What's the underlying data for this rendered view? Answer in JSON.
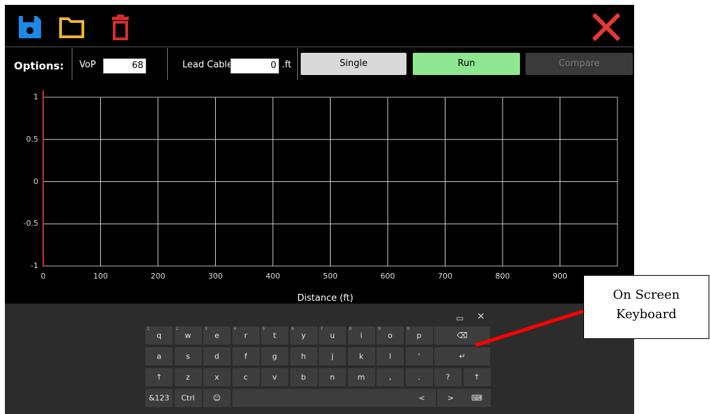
{
  "toolbar": {
    "icons": [
      "save-icon",
      "open-folder-icon",
      "delete-icon",
      "close-icon"
    ],
    "colors": {
      "save": "#1e88e5",
      "folder": "#f0b429",
      "delete": "#d32f2f",
      "close": "#e53935"
    }
  },
  "options": {
    "label": "Options:",
    "vop_label": "VoP",
    "vop_value": "68",
    "lead_cable_label": "Lead Cable",
    "lead_cable_value": "0",
    "lead_cable_unit": ".ft",
    "buttons": {
      "single": "Single",
      "run": "Run",
      "compare": "Compare"
    },
    "colors": {
      "single_bg": "#d9d9d9",
      "run_bg": "#8ee68e",
      "compare_bg": "#3a3a3a",
      "compare_text": "#7a7a7a"
    }
  },
  "chart_data": {
    "type": "line",
    "xlabel": "Distance (ft)",
    "ylabel": "",
    "title": "",
    "xlim": [
      0,
      1000
    ],
    "ylim": [
      -1,
      1
    ],
    "x_ticks": [
      "0",
      "100",
      "200",
      "300",
      "400",
      "500",
      "600",
      "700",
      "800",
      "900"
    ],
    "y_ticks": [
      "1",
      "0.5",
      "0",
      "-0.5",
      "-1"
    ],
    "grid": true,
    "series": [],
    "colors": {
      "background": "#000000",
      "grid": "#ffffff",
      "cursor": "#d32f2f"
    }
  },
  "keyboard": {
    "top_icons": [
      "keyboard-layout-icon",
      "close-icon"
    ],
    "close_symbol": "✕",
    "rows": [
      [
        {
          "k": "q",
          "s": "1"
        },
        {
          "k": "w",
          "s": "2"
        },
        {
          "k": "e",
          "s": "3"
        },
        {
          "k": "r",
          "s": "4"
        },
        {
          "k": "t",
          "s": "5"
        },
        {
          "k": "y",
          "s": "6"
        },
        {
          "k": "u",
          "s": "7"
        },
        {
          "k": "i",
          "s": "8"
        },
        {
          "k": "o",
          "s": "9"
        },
        {
          "k": "p",
          "s": "0"
        }
      ],
      [
        {
          "k": "a",
          "s": ""
        },
        {
          "k": "s",
          "s": ""
        },
        {
          "k": "d",
          "s": ""
        },
        {
          "k": "f",
          "s": ""
        },
        {
          "k": "g",
          "s": ""
        },
        {
          "k": "h",
          "s": ""
        },
        {
          "k": "j",
          "s": ""
        },
        {
          "k": "k",
          "s": ""
        },
        {
          "k": "l",
          "s": ""
        },
        {
          "k": "'",
          "s": ""
        }
      ],
      [
        {
          "k": "↑",
          "s": ""
        },
        {
          "k": "z",
          "s": ""
        },
        {
          "k": "x",
          "s": ""
        },
        {
          "k": "c",
          "s": ""
        },
        {
          "k": "v",
          "s": ""
        },
        {
          "k": "b",
          "s": ""
        },
        {
          "k": "n",
          "s": ""
        },
        {
          "k": "m",
          "s": ""
        },
        {
          "k": ",",
          "s": ""
        },
        {
          "k": ".",
          "s": ""
        },
        {
          "k": "?",
          "s": ""
        }
      ]
    ],
    "backspace": "⌫",
    "enter": "↵",
    "shift_right": "↑",
    "symbols_key": "&123",
    "ctrl_key": "Ctrl",
    "emoji_key": "☺",
    "left_arrow": "<",
    "right_arrow": ">",
    "keyboard_key": "⌨"
  },
  "callout": {
    "line1": "On Screen",
    "line2": "Keyboard",
    "pointer_color": "#ff0000"
  }
}
